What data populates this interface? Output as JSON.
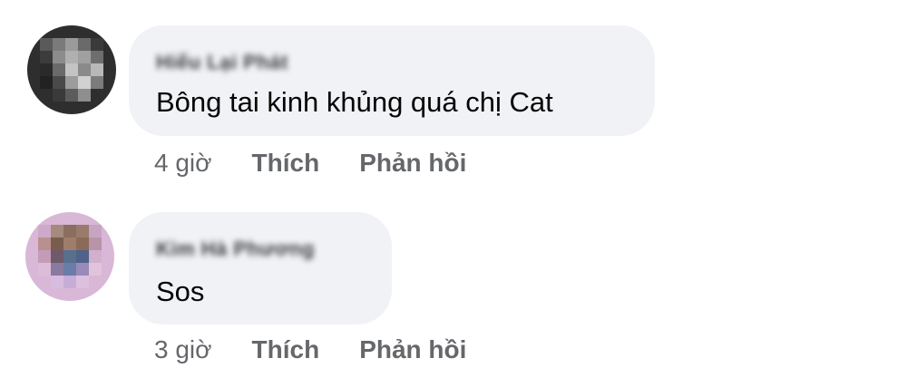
{
  "comments": [
    {
      "author": "Hiếu Lại Phát",
      "text": "Bông tai kinh khủng quá chị Cat",
      "time": "4 giờ",
      "like_label": "Thích",
      "reply_label": "Phản hồi"
    },
    {
      "author": "Kim Hà Phương",
      "text": "Sos",
      "time": "3 giờ",
      "like_label": "Thích",
      "reply_label": "Phản hồi"
    }
  ],
  "colors": {
    "bubble_bg": "#f0f2f5",
    "action_text": "#65676b",
    "body_text": "#050505"
  }
}
